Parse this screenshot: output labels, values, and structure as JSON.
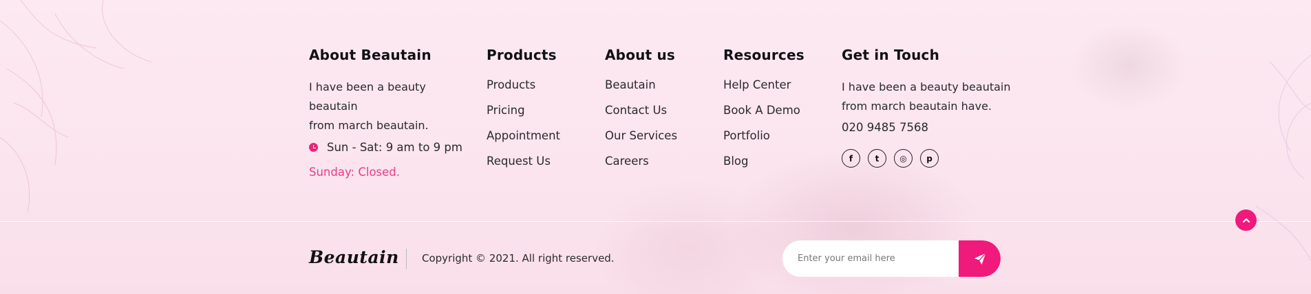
{
  "about": {
    "title": "About Beautain",
    "desc_line1": "I have been a beauty beautain",
    "desc_line2": "from march beautain.",
    "hours": "Sun - Sat: 9 am to 9 pm",
    "closed": "Sunday: Closed."
  },
  "products": {
    "title": "Products",
    "items": [
      "Products",
      "Pricing",
      "Appointment",
      "Request Us"
    ]
  },
  "about_us": {
    "title": "About us",
    "items": [
      "Beautain",
      "Contact Us",
      "Our Services",
      "Careers"
    ]
  },
  "resources": {
    "title": "Resources",
    "items": [
      "Help Center",
      "Book A Demo",
      "Portfolio",
      "Blog"
    ]
  },
  "touch": {
    "title": "Get in Touch",
    "desc_line1": "I have been a beauty beautain",
    "desc_line2": "from march beautain have.",
    "phone": "020 9485 7568",
    "socials": [
      {
        "icon": "facebook-icon",
        "glyph": "f"
      },
      {
        "icon": "twitter-icon",
        "glyph": "t"
      },
      {
        "icon": "instagram-icon",
        "glyph": "◎"
      },
      {
        "icon": "pinterest-icon",
        "glyph": "p"
      }
    ]
  },
  "bottom": {
    "logo": "Beautain",
    "copyright": "Copyright © 2021. All right reserved.",
    "email_placeholder": "Enter your email here"
  },
  "colors": {
    "accent": "#f0197c",
    "closed_text": "#e53d88"
  }
}
